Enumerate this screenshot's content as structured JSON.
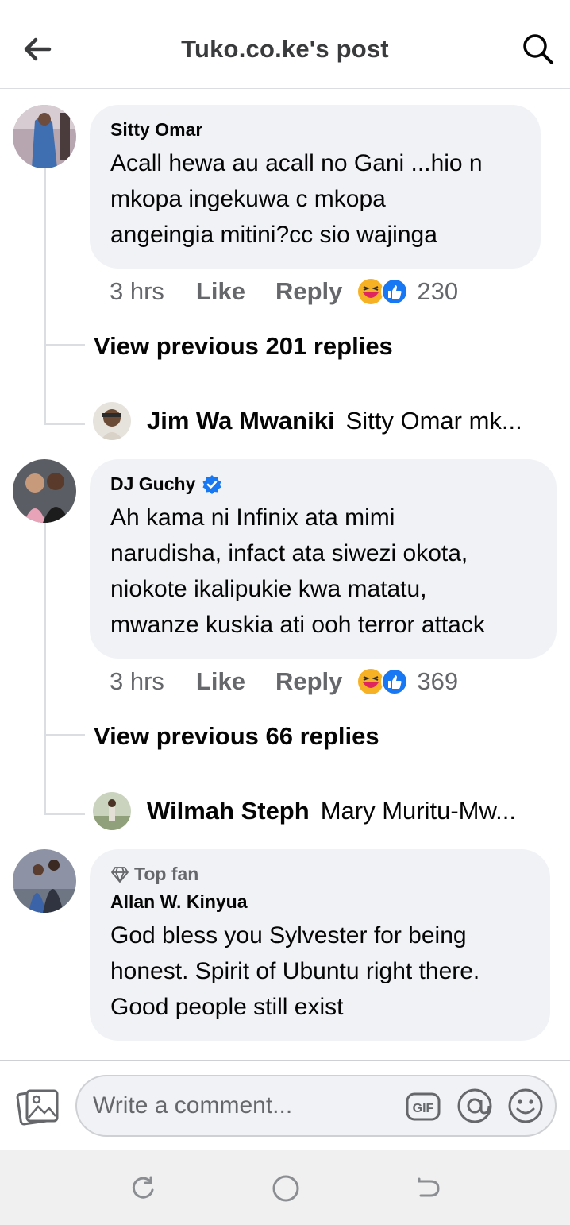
{
  "header": {
    "title": "Tuko.co.ke's post"
  },
  "comments": [
    {
      "author": "Sitty Omar",
      "text_lines": [
        "Acall hewa au acall no Gani ...hio n",
        "mkopa ingekuwa c mkopa",
        "angeingia mitini?cc sio wajinga"
      ],
      "time": "3 hrs",
      "like_label": "Like",
      "reply_label": "Reply",
      "reaction_count": "230",
      "view_previous": "View previous 201 replies",
      "latest_reply": {
        "name": "Jim Wa Mwaniki",
        "text": "Sitty Omar mk..."
      }
    },
    {
      "author": "DJ Guchy",
      "verified": true,
      "text_lines": [
        "Ah kama ni Infinix ata mimi",
        "narudisha, infact ata siwezi okota,",
        "niokote ikalipukie kwa matatu,",
        "mwanze kuskia ati ooh terror attack"
      ],
      "time": "3 hrs",
      "like_label": "Like",
      "reply_label": "Reply",
      "reaction_count": "369",
      "view_previous": "View previous 66 replies",
      "latest_reply": {
        "name": "Wilmah Steph",
        "text": "Mary Muritu-Mw..."
      }
    },
    {
      "badge": "Top fan",
      "author": "Allan W. Kinyua",
      "text_lines": [
        "God bless you Sylvester for being",
        "honest. Spirit of Ubuntu right there.",
        "Good people still exist"
      ]
    }
  ],
  "composer": {
    "placeholder": "Write a comment...",
    "gif_label": "GIF"
  },
  "colors": {
    "bubble": "#f0f2f5",
    "secondary_text": "#65676b",
    "verified": "#1877f2",
    "like_blue": "#1877f2",
    "haha_yellow": "#f7b125"
  },
  "icons": [
    "back-arrow-icon",
    "search-icon",
    "verified-badge-icon",
    "haha-reaction-icon",
    "like-reaction-icon",
    "diamond-icon",
    "photo-icon",
    "gif-icon",
    "at-mention-icon",
    "emoji-icon",
    "recent-apps-icon",
    "home-icon",
    "back-nav-icon"
  ]
}
